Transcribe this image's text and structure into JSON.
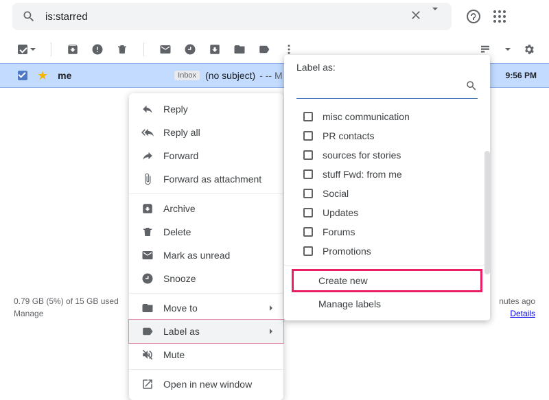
{
  "search": {
    "query": "is:starred"
  },
  "email": {
    "sender": "me",
    "inbox_badge": "Inbox",
    "subject": "(no subject)",
    "snippet": " - -- M",
    "time": "9:56 PM"
  },
  "context_menu": {
    "reply": "Reply",
    "reply_all": "Reply all",
    "forward": "Forward",
    "forward_attachment": "Forward as attachment",
    "archive": "Archive",
    "delete": "Delete",
    "mark_unread": "Mark as unread",
    "snooze": "Snooze",
    "move_to": "Move to",
    "label_as": "Label as",
    "mute": "Mute",
    "open_new_window": "Open in new window"
  },
  "label_panel": {
    "title": "Label as:",
    "items": [
      "misc communication",
      "PR contacts",
      "sources for stories",
      "stuff Fwd: from me",
      "Social",
      "Updates",
      "Forums",
      "Promotions"
    ],
    "create_new": "Create new",
    "manage_labels": "Manage labels"
  },
  "footer": {
    "storage": "0.79 GB (5%) of 15 GB used",
    "manage": "Manage",
    "activity": "nutes ago",
    "details": "Details"
  }
}
